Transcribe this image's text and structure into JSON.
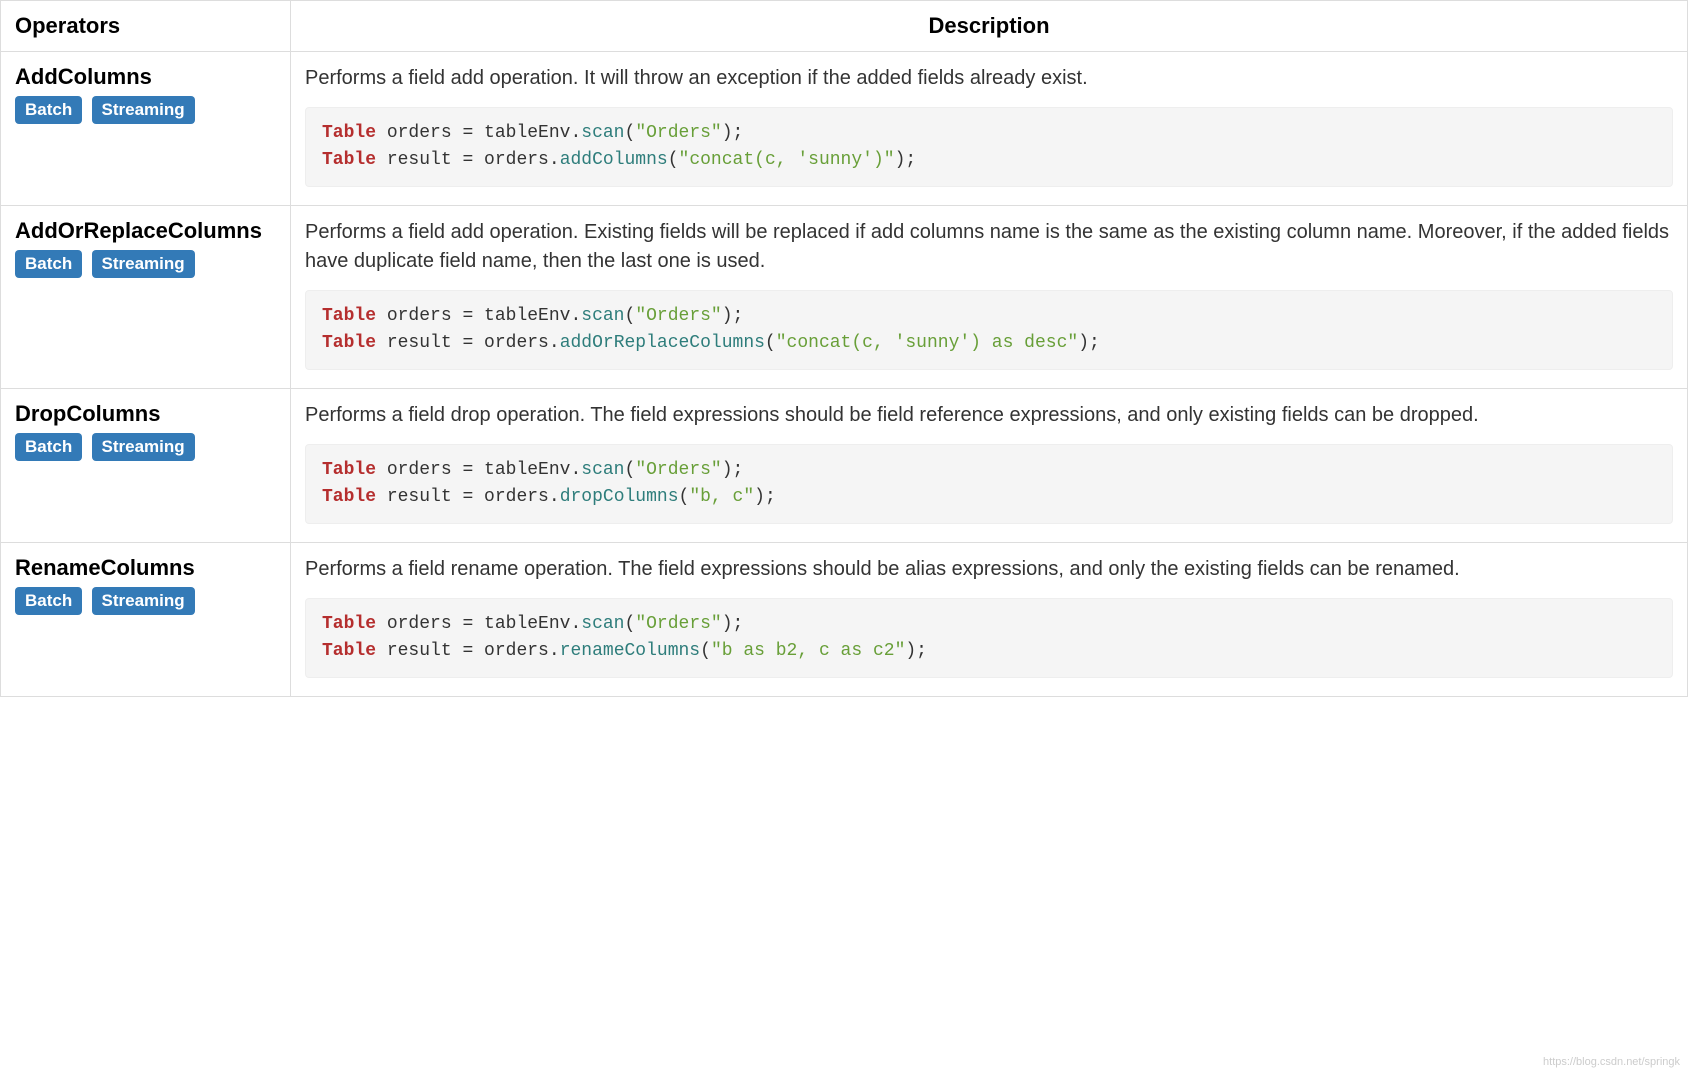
{
  "headers": {
    "operators": "Operators",
    "description": "Description"
  },
  "badges": {
    "batch": "Batch",
    "streaming": "Streaming"
  },
  "rows": [
    {
      "name": "AddColumns",
      "desc": "Performs a field add operation. It will throw an exception if the added fields already exist.",
      "code": {
        "l1_type": "Table",
        "l1_var": " orders ",
        "l1_eq": "=",
        "l1_obj": " tableEnv",
        "l1_dot": ".",
        "l1_m": "scan",
        "l1_op": "(",
        "l1_s": "\"Orders\"",
        "l1_cp": ");",
        "l2_type": "Table",
        "l2_var": " result ",
        "l2_eq": "=",
        "l2_obj": " orders",
        "l2_dot": ".",
        "l2_m": "addColumns",
        "l2_op": "(",
        "l2_s": "\"concat(c, 'sunny')\"",
        "l2_cp": ");"
      }
    },
    {
      "name": "AddOrReplaceColumns",
      "desc": "Performs a field add operation. Existing fields will be replaced if add columns name is the same as the existing column name. Moreover, if the added fields have duplicate field name, then the last one is used.",
      "code": {
        "l1_type": "Table",
        "l1_var": " orders ",
        "l1_eq": "=",
        "l1_obj": " tableEnv",
        "l1_dot": ".",
        "l1_m": "scan",
        "l1_op": "(",
        "l1_s": "\"Orders\"",
        "l1_cp": ");",
        "l2_type": "Table",
        "l2_var": " result ",
        "l2_eq": "=",
        "l2_obj": " orders",
        "l2_dot": ".",
        "l2_m": "addOrReplaceColumns",
        "l2_op": "(",
        "l2_s": "\"concat(c, 'sunny') as desc\"",
        "l2_cp": ");"
      }
    },
    {
      "name": "DropColumns",
      "desc": "Performs a field drop operation. The field expressions should be field reference expressions, and only existing fields can be dropped.",
      "code": {
        "l1_type": "Table",
        "l1_var": " orders ",
        "l1_eq": "=",
        "l1_obj": " tableEnv",
        "l1_dot": ".",
        "l1_m": "scan",
        "l1_op": "(",
        "l1_s": "\"Orders\"",
        "l1_cp": ");",
        "l2_type": "Table",
        "l2_var": " result ",
        "l2_eq": "=",
        "l2_obj": " orders",
        "l2_dot": ".",
        "l2_m": "dropColumns",
        "l2_op": "(",
        "l2_s": "\"b, c\"",
        "l2_cp": ");"
      }
    },
    {
      "name": "RenameColumns",
      "desc": "Performs a field rename operation. The field expressions should be alias expressions, and only the existing fields can be renamed.",
      "code": {
        "l1_type": "Table",
        "l1_var": " orders ",
        "l1_eq": "=",
        "l1_obj": " tableEnv",
        "l1_dot": ".",
        "l1_m": "scan",
        "l1_op": "(",
        "l1_s": "\"Orders\"",
        "l1_cp": ");",
        "l2_type": "Table",
        "l2_var": " result ",
        "l2_eq": "=",
        "l2_obj": " orders",
        "l2_dot": ".",
        "l2_m": "renameColumns",
        "l2_op": "(",
        "l2_s": "\"b as b2, c as c2\"",
        "l2_cp": ");"
      }
    }
  ],
  "watermark": "https://blog.csdn.net/springk"
}
